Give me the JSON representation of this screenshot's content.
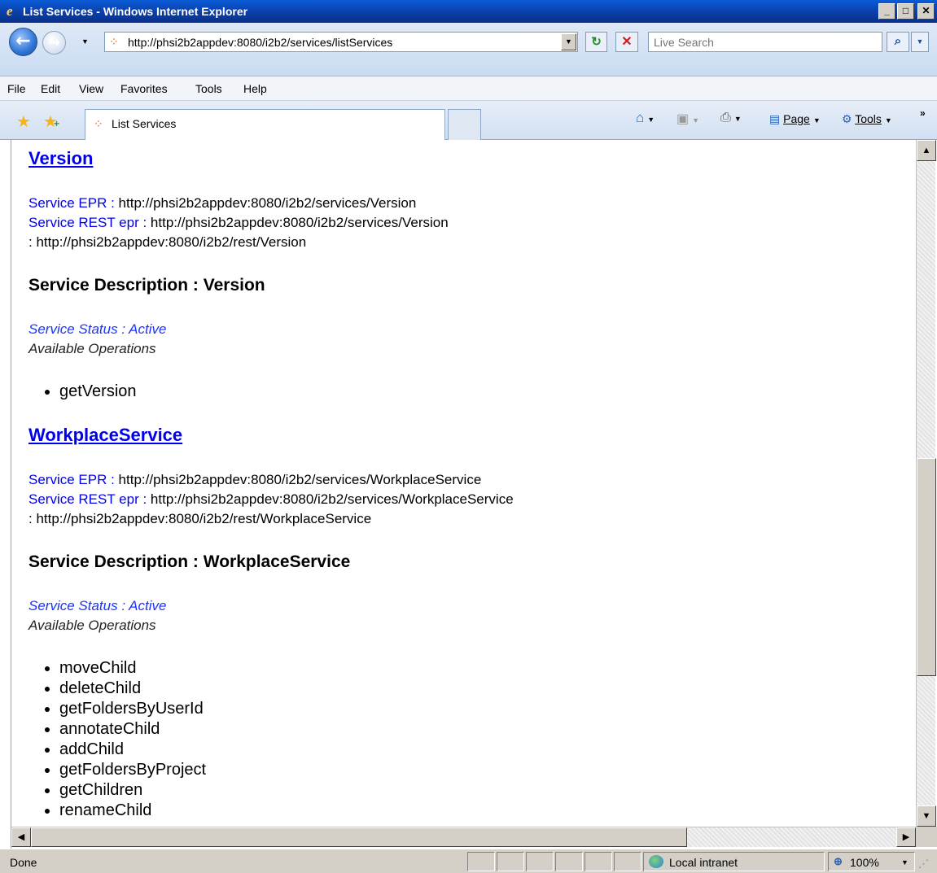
{
  "window": {
    "title": "List Services - Windows Internet Explorer",
    "minimize": "_",
    "maximize": "□",
    "close": "✕"
  },
  "address": {
    "url": "http://phsi2b2appdev:8080/i2b2/services/listServices",
    "search_placeholder": "Live Search"
  },
  "menu": {
    "file": "File",
    "edit": "Edit",
    "view": "View",
    "favorites": "Favorites",
    "tools": "Tools",
    "help": "Help"
  },
  "tab": {
    "label": "List Services"
  },
  "commands": {
    "page": "Page",
    "tools": "Tools"
  },
  "services": [
    {
      "name": "Version",
      "epr_label": "Service EPR :",
      "epr": "http://phsi2b2appdev:8080/i2b2/services/Version",
      "rest_label": "Service REST epr :",
      "rest_epr": "http://phsi2b2appdev:8080/i2b2/services/Version",
      "rest_line2": ": http://phsi2b2appdev:8080/i2b2/rest/Version",
      "description": "Service Description : Version",
      "status": "Service Status : Active",
      "operations_label": "Available Operations",
      "operations": [
        "getVersion"
      ]
    },
    {
      "name": "WorkplaceService",
      "epr_label": "Service EPR :",
      "epr": "http://phsi2b2appdev:8080/i2b2/services/WorkplaceService",
      "rest_label": "Service REST epr :",
      "rest_epr": "http://phsi2b2appdev:8080/i2b2/services/WorkplaceService",
      "rest_line2": ": http://phsi2b2appdev:8080/i2b2/rest/WorkplaceService",
      "description": "Service Description : WorkplaceService",
      "status": "Service Status : Active",
      "operations_label": "Available Operations",
      "operations": [
        "moveChild",
        "deleteChild",
        "getFoldersByUserId",
        "annotateChild",
        "addChild",
        "getFoldersByProject",
        "getChildren",
        "renameChild"
      ]
    }
  ],
  "status": {
    "text": "Done",
    "zone": "Local intranet",
    "zoom": "100%"
  }
}
